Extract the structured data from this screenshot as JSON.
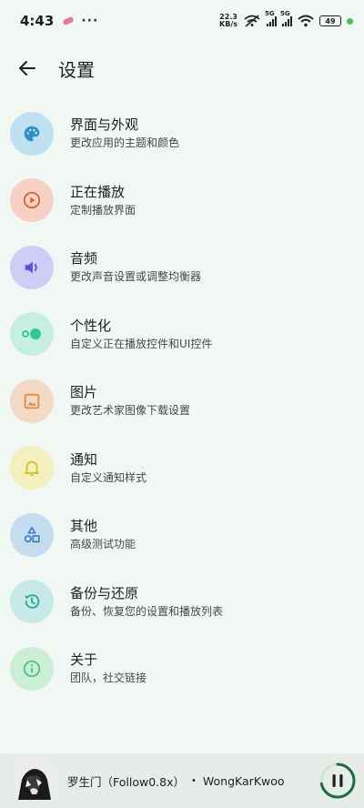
{
  "status_bar": {
    "time": "4:43",
    "dots": "···",
    "net_speed_value": "22.3",
    "net_speed_unit": "KB/s",
    "sig1_label": "5G",
    "sig2_label": "5G",
    "battery": "49"
  },
  "header": {
    "title": "设置"
  },
  "items": [
    {
      "title": "界面与外观",
      "subtitle": "更改应用的主题和颜色",
      "icon": "palette-icon",
      "bg": "#bfe0f0",
      "fg": "#2d8fc7"
    },
    {
      "title": "正在播放",
      "subtitle": "定制播放界面",
      "icon": "play-circle-icon",
      "bg": "#f6d1c4",
      "fg": "#e0603a"
    },
    {
      "title": "音频",
      "subtitle": "更改声音设置或调整均衡器",
      "icon": "volume-icon",
      "bg": "#cfcdf6",
      "fg": "#5b4fe0"
    },
    {
      "title": "个性化",
      "subtitle": "自定义正在播放控件和UI控件",
      "icon": "toggle-icon",
      "bg": "#c6efe2",
      "fg": "#2cc79a"
    },
    {
      "title": "图片",
      "subtitle": "更改艺术家图像下载设置",
      "icon": "image-icon",
      "bg": "#f3dac7",
      "fg": "#e38a3f"
    },
    {
      "title": "通知",
      "subtitle": "自定义通知样式",
      "icon": "bell-icon",
      "bg": "#f3f0bd",
      "fg": "#d4c12c"
    },
    {
      "title": "其他",
      "subtitle": "高级测试功能",
      "icon": "shapes-icon",
      "bg": "#c5dcef",
      "fg": "#3a7fc0"
    },
    {
      "title": "备份与还原",
      "subtitle": "备份、恢复您的设置和播放列表",
      "icon": "restore-icon",
      "bg": "#c7eae8",
      "fg": "#2fa6a0"
    },
    {
      "title": "关于",
      "subtitle": "团队，社交链接",
      "icon": "info-icon",
      "bg": "#cdeed6",
      "fg": "#4fc57a"
    }
  ],
  "player": {
    "track": "罗生门（Follow0.8x）",
    "separator": "•",
    "artist": "WongKarKwoo",
    "progress": 0.72,
    "accent": "#1f6b43"
  }
}
